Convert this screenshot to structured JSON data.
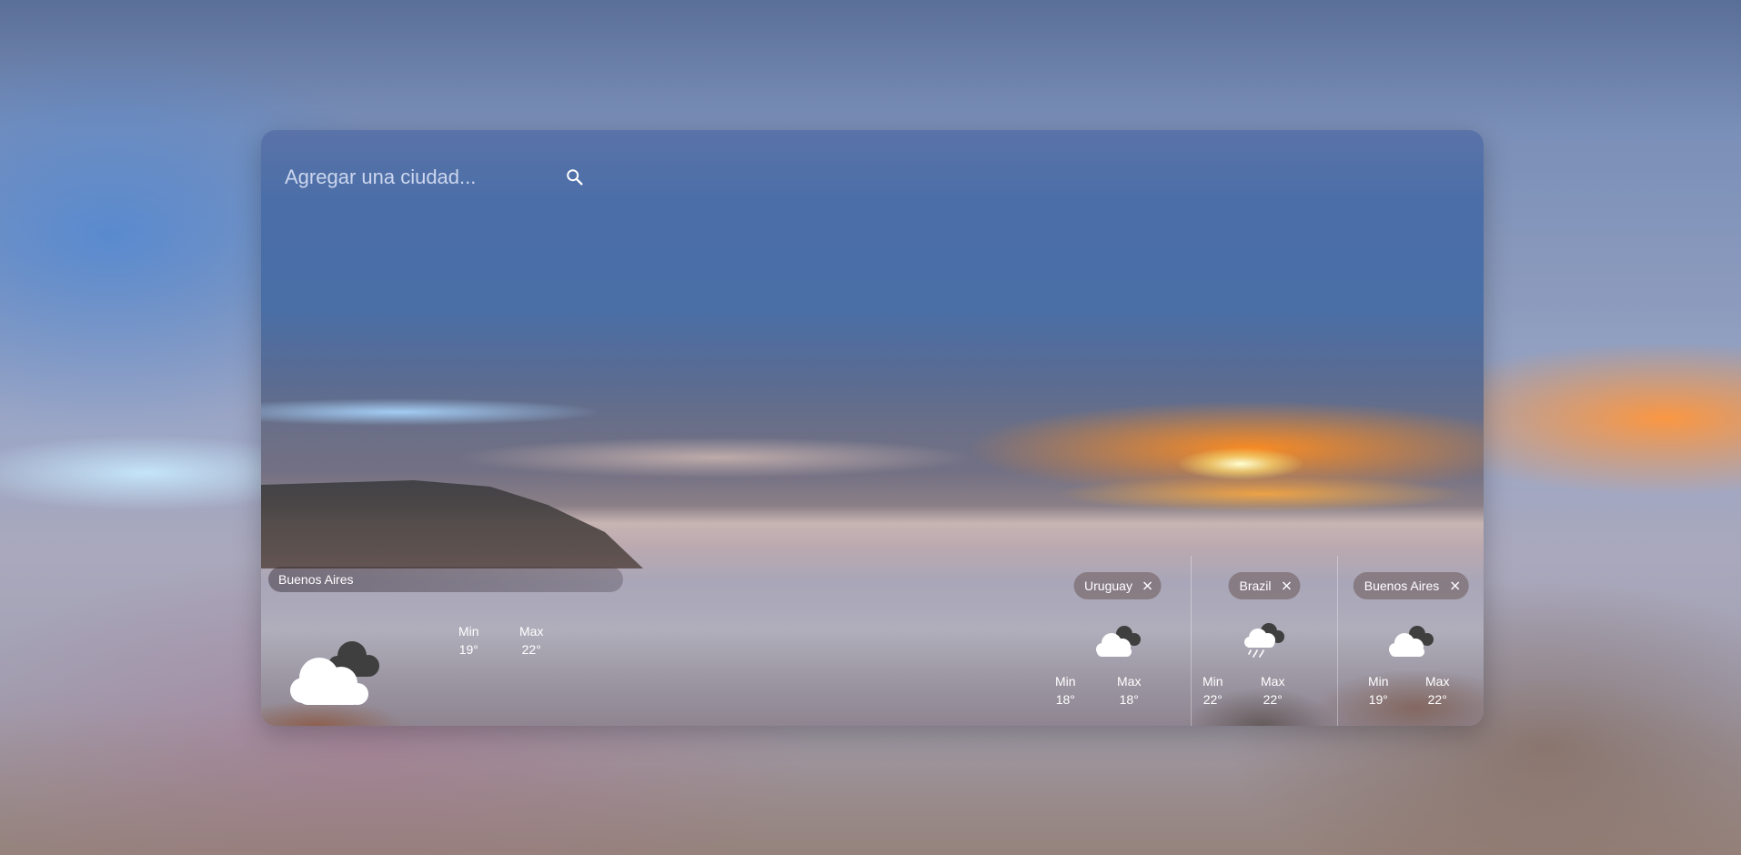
{
  "search": {
    "placeholder": "Agregar una ciudad..."
  },
  "current": {
    "city": "Buenos Aires",
    "icon": "partly-cloudy-icon",
    "min_label": "Min",
    "min_value": "19°",
    "max_label": "Max",
    "max_value": "22°"
  },
  "cities": [
    {
      "name": "Uruguay",
      "icon": "cloudy-icon",
      "min_label": "Min",
      "min_value": "18°",
      "max_label": "Max",
      "max_value": "18°"
    },
    {
      "name": "Brazil",
      "icon": "rain-icon",
      "min_label": "Min",
      "min_value": "22°",
      "max_label": "Max",
      "max_value": "22°"
    },
    {
      "name": "Buenos Aires",
      "icon": "cloudy-icon",
      "min_label": "Min",
      "min_value": "19°",
      "max_label": "Max",
      "max_value": "22°"
    }
  ]
}
